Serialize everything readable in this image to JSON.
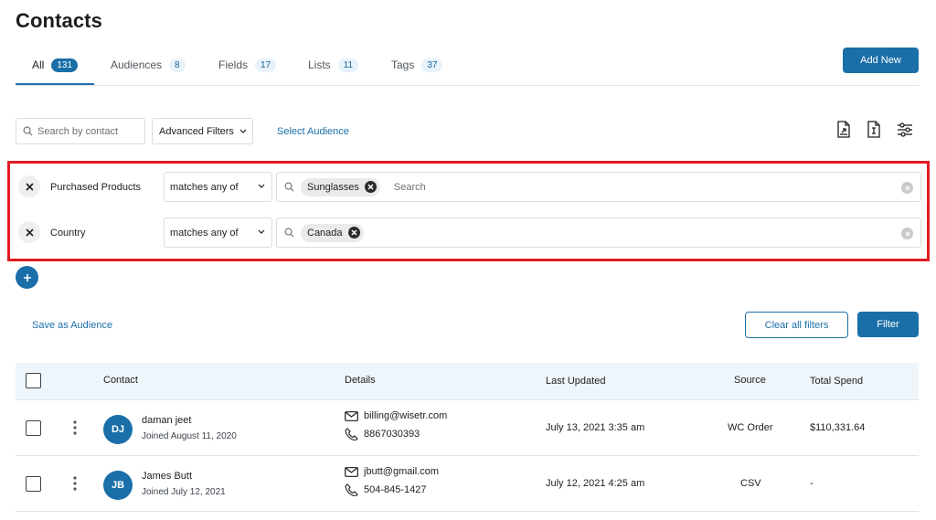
{
  "page": {
    "title": "Contacts"
  },
  "tabs": [
    {
      "label": "All",
      "count": "131",
      "active": true
    },
    {
      "label": "Audiences",
      "count": "8"
    },
    {
      "label": "Fields",
      "count": "17"
    },
    {
      "label": "Lists",
      "count": "11"
    },
    {
      "label": "Tags",
      "count": "37"
    }
  ],
  "header": {
    "add_new_label": "Add New"
  },
  "toolbar": {
    "search_placeholder": "Search by contact",
    "advanced_filters_label": "Advanced Filters",
    "select_audience_label": "Select Audience",
    "icons": [
      "import-icon",
      "export-icon",
      "column-settings-icon"
    ]
  },
  "filters": [
    {
      "field": "Purchased Products",
      "operator": "matches any of",
      "values": [
        "Sunglasses"
      ],
      "search_placeholder": "Search"
    },
    {
      "field": "Country",
      "operator": "matches any of",
      "values": [
        "Canada"
      ],
      "search_placeholder": ""
    }
  ],
  "actions": {
    "save_audience_label": "Save as Audience",
    "clear_filters_label": "Clear all filters",
    "filter_label": "Filter"
  },
  "table": {
    "columns": [
      "Contact",
      "Details",
      "Last Updated",
      "Source",
      "Total Spend"
    ],
    "rows": [
      {
        "initials": "DJ",
        "name": "daman jeet",
        "joined": "Joined August 11, 2020",
        "email": "billing@wisetr.com",
        "phone": "8867030393",
        "last_updated": "July 13, 2021 3:35 am",
        "source": "WC Order",
        "total_spend": "$110,331.64"
      },
      {
        "initials": "JB",
        "name": "James Butt",
        "joined": "Joined July 12, 2021",
        "email": "jbutt@gmail.com",
        "phone": "504-845-1427",
        "last_updated": "July 12, 2021 4:25 am",
        "source": "CSV",
        "total_spend": "-"
      }
    ]
  },
  "colors": {
    "accent": "#1a6fa8",
    "highlight_border": "#e21b22",
    "header_bg": "#eef5fb"
  }
}
